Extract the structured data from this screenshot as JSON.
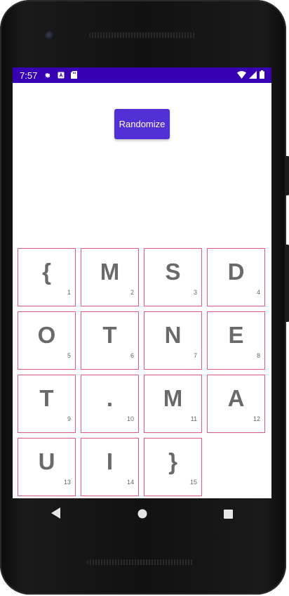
{
  "status_bar": {
    "time": "7:57",
    "left_icons": [
      "gear-icon",
      "text-a-icon",
      "sd-card-icon"
    ],
    "right_icons": [
      "wifi-icon",
      "signal-icon",
      "battery-icon"
    ],
    "color": "#3700b3"
  },
  "app": {
    "randomize_label": "Randomize",
    "button_color": "#5330d6",
    "tile_border_color": "#e35a8f",
    "tiles": [
      {
        "char": "{",
        "num": "1"
      },
      {
        "char": "M",
        "num": "2"
      },
      {
        "char": "S",
        "num": "3"
      },
      {
        "char": "D",
        "num": "4"
      },
      {
        "char": "O",
        "num": "5"
      },
      {
        "char": "T",
        "num": "6"
      },
      {
        "char": "N",
        "num": "7"
      },
      {
        "char": "E",
        "num": "8"
      },
      {
        "char": "T",
        "num": "9"
      },
      {
        "char": ".",
        "num": "10"
      },
      {
        "char": "M",
        "num": "11"
      },
      {
        "char": "A",
        "num": "12"
      },
      {
        "char": "U",
        "num": "13"
      },
      {
        "char": "I",
        "num": "14"
      },
      {
        "char": "}",
        "num": "15"
      }
    ]
  },
  "nav_bar": {
    "icons": [
      "back-icon",
      "home-icon",
      "recents-icon"
    ]
  }
}
